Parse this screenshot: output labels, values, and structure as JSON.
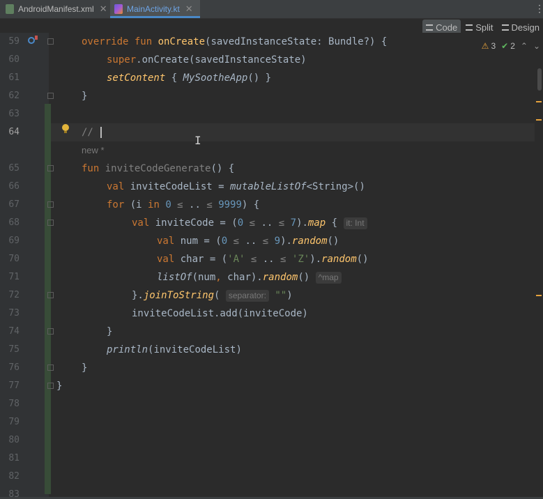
{
  "tabs": [
    {
      "label": "AndroidManifest.xml",
      "active": false,
      "icon": "android-manifest-icon"
    },
    {
      "label": "MainActivity.kt",
      "active": true,
      "icon": "kotlin-file-icon"
    }
  ],
  "view_modes": {
    "code": "Code",
    "split": "Split",
    "design": "Design",
    "active": "Code"
  },
  "inspections": {
    "warnings": "3",
    "weak_warnings": "2"
  },
  "line_numbers": [
    "59",
    "60",
    "61",
    "62",
    "63",
    "64",
    "65",
    "66",
    "67",
    "68",
    "69",
    "70",
    "71",
    "72",
    "73",
    "74",
    "75",
    "76",
    "77",
    "78",
    "79",
    "80",
    "81",
    "82",
    "83"
  ],
  "current_line": "64",
  "ghost_hint": "new *",
  "code": {
    "l59a": "override fun ",
    "l59fn": "onCreate",
    "l59b": "(savedInstanceState: Bundle?) {",
    "l60kw": "super",
    "l60b": ".onCreate(savedInstanceState)",
    "l61fn": "setContent",
    "l61b": " { ",
    "l61c": "MySootheApp",
    "l61d": "() }",
    "l62": "}",
    "l64": "// ",
    "l65kw": "fun ",
    "l65fn": "inviteCodeGenerate",
    "l65b": "() {",
    "l66kw": "val ",
    "l66b": "inviteCodeList = ",
    "l66fn": "mutableListOf",
    "l66c": "<String>()",
    "l67kw": "for ",
    "l67b": "(i ",
    "l67kw2": "in ",
    "l67n1": "0",
    "l67h1": " ≤ ",
    "l67c": "..",
    "l67h2": " ≤ ",
    "l67n2": "9999",
    "l67d": ") {",
    "l68kw": "val ",
    "l68b": "inviteCode = (",
    "l68n1": "0",
    "l68h1": " ≤ ",
    "l68c": "..",
    "l68h2": " ≤ ",
    "l68n2": "7",
    "l68d": ").",
    "l68fn": "map",
    "l68e": " { ",
    "l68hint": "it: Int",
    "l69kw": "val ",
    "l69b": "num = (",
    "l69n1": "0",
    "l69h1": " ≤ ",
    "l69c": "..",
    "l69h2": " ≤ ",
    "l69n2": "9",
    "l69d": ").",
    "l69fn": "random",
    "l69e": "()",
    "l70kw": "val ",
    "l70b": "char = (",
    "l70s1": "'A'",
    "l70h1": " ≤ ",
    "l70c": "..",
    "l70h2": " ≤ ",
    "l70s2": "'Z'",
    "l70d": ").",
    "l70fn": "random",
    "l70e": "()",
    "l71fn": "listOf",
    "l71b": "(num",
    "l71k": ", ",
    "l71c": "char).",
    "l71fn2": "random",
    "l71d": "() ",
    "l71hint": "^map",
    "l72a": "}.",
    "l72fn": "joinToString",
    "l72b": "( ",
    "l72hint": "separator:",
    "l72s": " \"\"",
    "l72c": ")",
    "l73": "inviteCodeList.add(inviteCode)",
    "l74": "}",
    "l75fn": "println",
    "l75b": "(inviteCodeList)",
    "l76": "}",
    "l77": "}"
  }
}
